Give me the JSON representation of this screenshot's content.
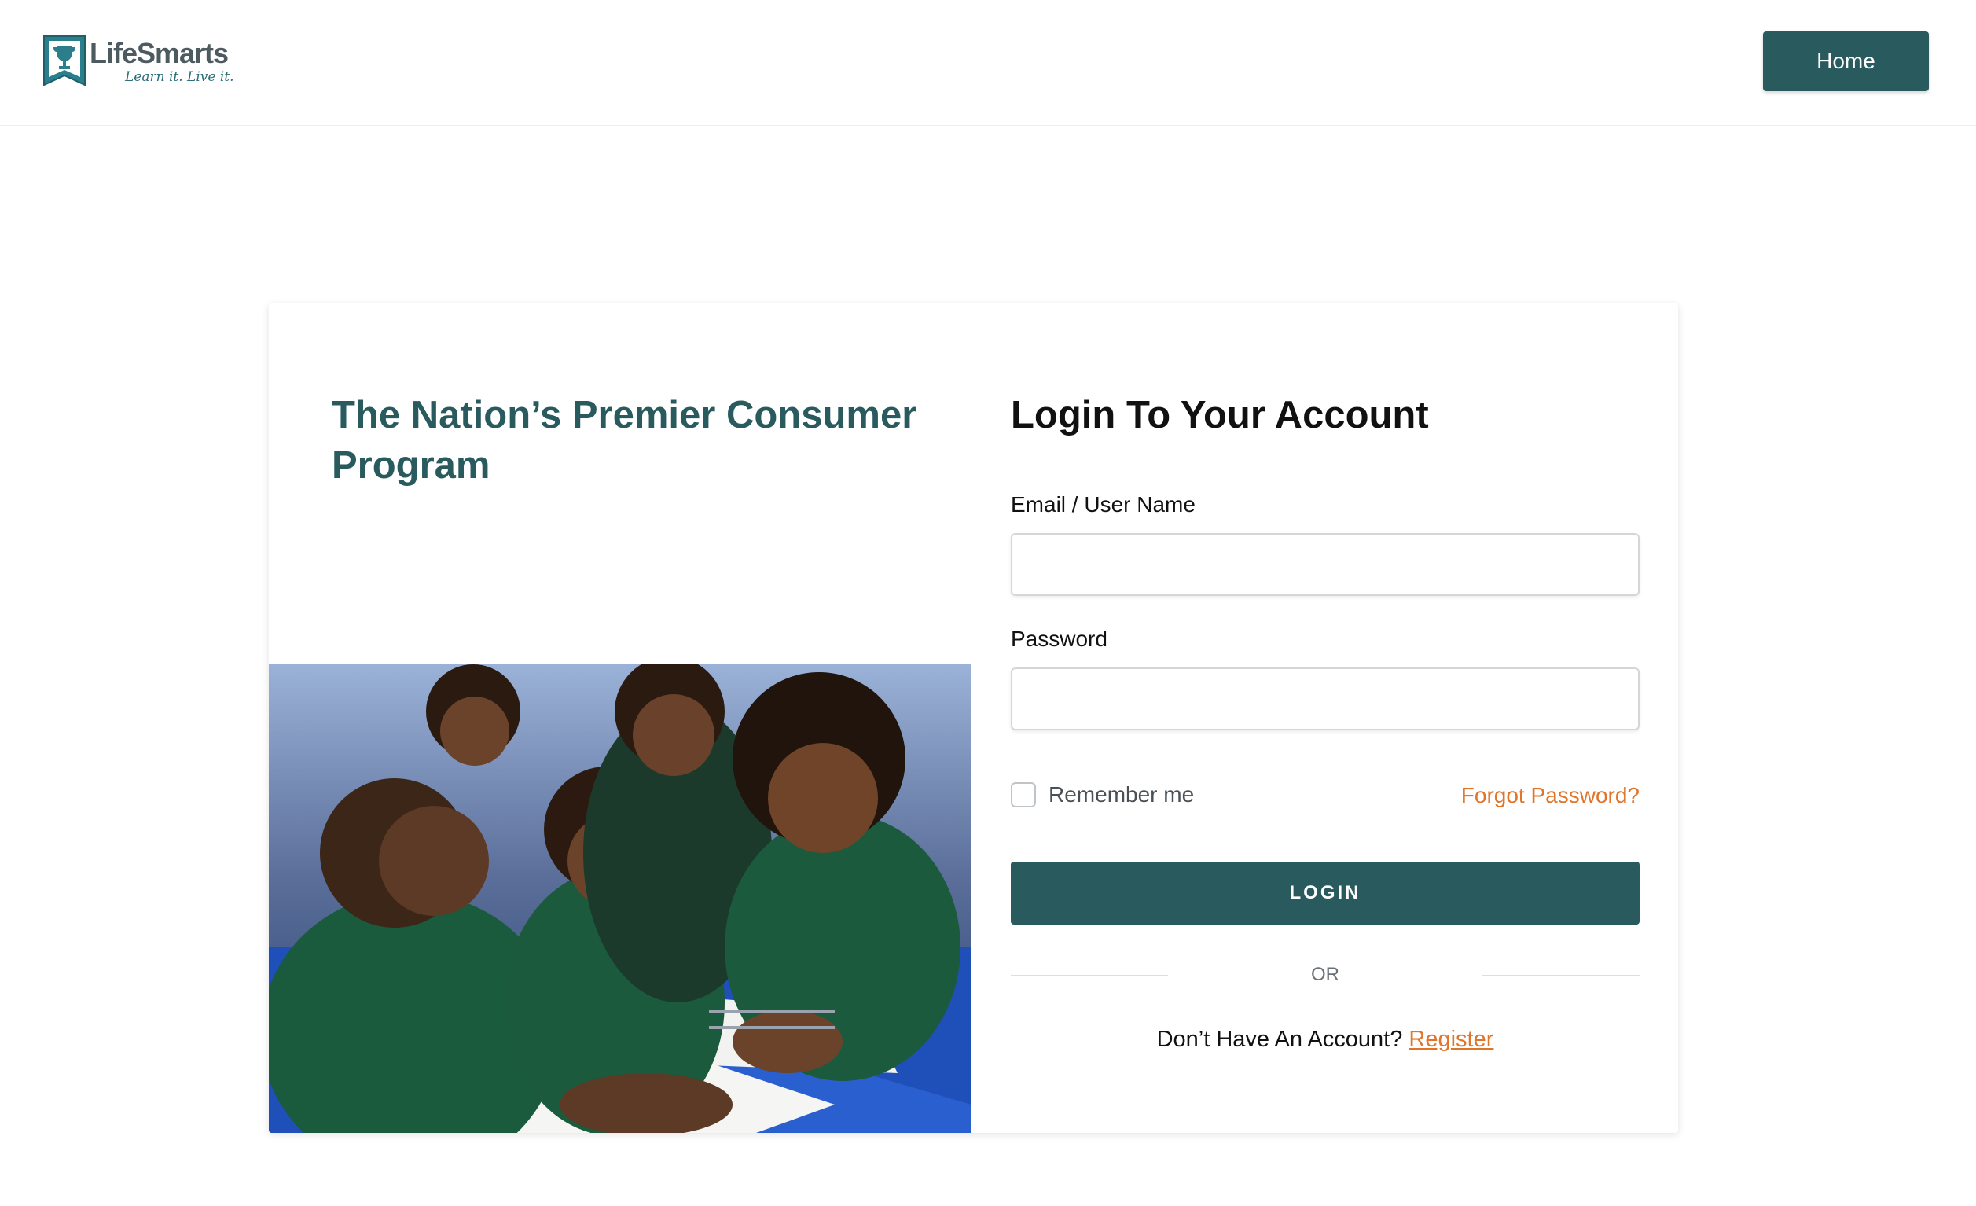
{
  "header": {
    "logo_name": "LifeSmarts",
    "logo_tagline": "Learn it. Live it.",
    "home_label": "Home"
  },
  "hero": {
    "tagline": "The Nation’s Premier Consumer Program"
  },
  "login": {
    "title": "Login To Your Account",
    "email_label": "Email / User Name",
    "email_value": "",
    "password_label": "Password",
    "password_value": "",
    "remember_label": "Remember me",
    "forgot_label": "Forgot Password?",
    "submit_label": "LOGIN",
    "divider_text": "OR",
    "no_account_text": "Don’t Have An Account?",
    "register_label": "Register"
  },
  "colors": {
    "brand": "#285a5e",
    "accent": "#e0752a",
    "photo_table": "#1f4fb8",
    "photo_shirts": "#1b5a3c"
  },
  "icons": {
    "logo": "trophy-ribbon-logo",
    "checkbox": "checkbox-unchecked"
  }
}
